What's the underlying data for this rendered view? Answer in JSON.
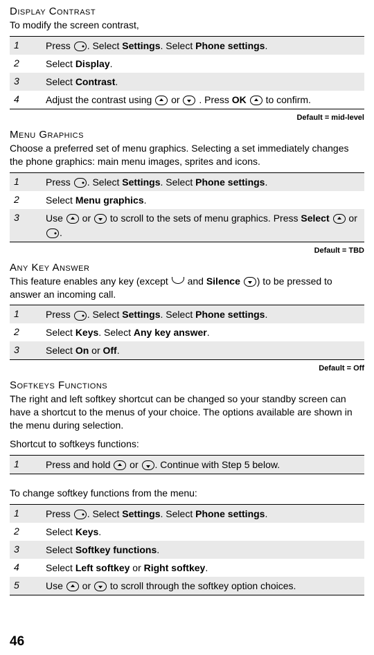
{
  "pageNumber": "46",
  "sections": [
    {
      "title": "Display Contrast",
      "intro": "To modify the screen contrast,",
      "steps": [
        {
          "n": "1",
          "parts": [
            "Press ",
            "{icon:dot}",
            ". Select  ",
            "{b:Settings}",
            ". Select  ",
            "{b:Phone settings}",
            "."
          ]
        },
        {
          "n": "2",
          "parts": [
            "Select  ",
            "{b:Display}",
            "."
          ]
        },
        {
          "n": "3",
          "parts": [
            "Select  ",
            "{b:Contrast}",
            "."
          ]
        },
        {
          "n": "4",
          "parts": [
            "Adjust the contrast using ",
            "{icon:up}",
            " or ",
            "{icon:down}",
            " . Press ",
            "{b:OK}",
            " ",
            "{icon:up}",
            " to confirm."
          ]
        }
      ],
      "default": "Default = mid-level"
    },
    {
      "title": "Menu Graphics",
      "intro": "Choose a preferred set of menu graphics. Selecting a set immediately changes the phone graphics:  main menu images, sprites and icons.",
      "steps": [
        {
          "n": "1",
          "parts": [
            "Press ",
            "{icon:dot}",
            ". Select  ",
            "{b:Settings}",
            ". Select  ",
            "{b:Phone settings}",
            "."
          ]
        },
        {
          "n": "2",
          "parts": [
            "Select  ",
            "{b:Menu graphics}",
            "."
          ]
        },
        {
          "n": "3",
          "parts": [
            "Use ",
            "{icon:up}",
            " or ",
            "{icon:down}",
            " to scroll to the sets of menu graphics. Press  ",
            "{b:Select}",
            " ",
            "{icon:up}",
            "  or ",
            "{icon:dot}",
            "."
          ]
        }
      ],
      "default": "Default = TBD"
    },
    {
      "title": "Any Key Answer",
      "introParts": [
        "This feature enables any key (except ",
        "{icon:cup}",
        " and  ",
        "{b:Silence}",
        " ",
        "{icon:down}",
        ") to be pressed to answer an incoming call."
      ],
      "steps": [
        {
          "n": "1",
          "parts": [
            "Press ",
            "{icon:dot}",
            ". Select  ",
            "{b:Settings}",
            ". Select  ",
            "{b:Phone settings}",
            "."
          ]
        },
        {
          "n": "2",
          "parts": [
            "Select  ",
            "{b:Keys}",
            ". Select  ",
            "{b:Any key answer}",
            "."
          ]
        },
        {
          "n": "3",
          "parts": [
            "Select  ",
            "{b:On}",
            " or  ",
            "{b:Off}",
            "."
          ]
        }
      ],
      "default": "Default = Off"
    },
    {
      "title": "Softkeys Functions",
      "intro": "The right and left softkey shortcut can be changed so your standby screen can have a shortcut to the menus of your choice. The options available are shown in the menu during selection.",
      "sub1": "Shortcut to softkeys functions:",
      "steps1": [
        {
          "n": "1",
          "parts": [
            "Press and hold  ",
            "{icon:up}",
            " or ",
            "{icon:down}",
            ". Continue with Step 5 below."
          ]
        }
      ],
      "sub2": "To change softkey functions from the menu:",
      "steps2": [
        {
          "n": "1",
          "parts": [
            "Press ",
            "{icon:dot}",
            ". Select  ",
            "{b:Settings}",
            ". Select  ",
            "{b:Phone settings}",
            "."
          ]
        },
        {
          "n": "2",
          "parts": [
            "Select  ",
            "{b:Keys}",
            "."
          ]
        },
        {
          "n": "3",
          "parts": [
            "Select  ",
            "{b:Softkey functions}",
            "."
          ]
        },
        {
          "n": "4",
          "parts": [
            "Select  ",
            "{b:Left softkey}",
            " or  ",
            "{b:Right softkey}",
            "."
          ]
        },
        {
          "n": "5",
          "parts": [
            "Use ",
            "{icon:up}",
            " or ",
            "{icon:down}",
            " to scroll through the softkey option choices."
          ]
        }
      ]
    }
  ]
}
